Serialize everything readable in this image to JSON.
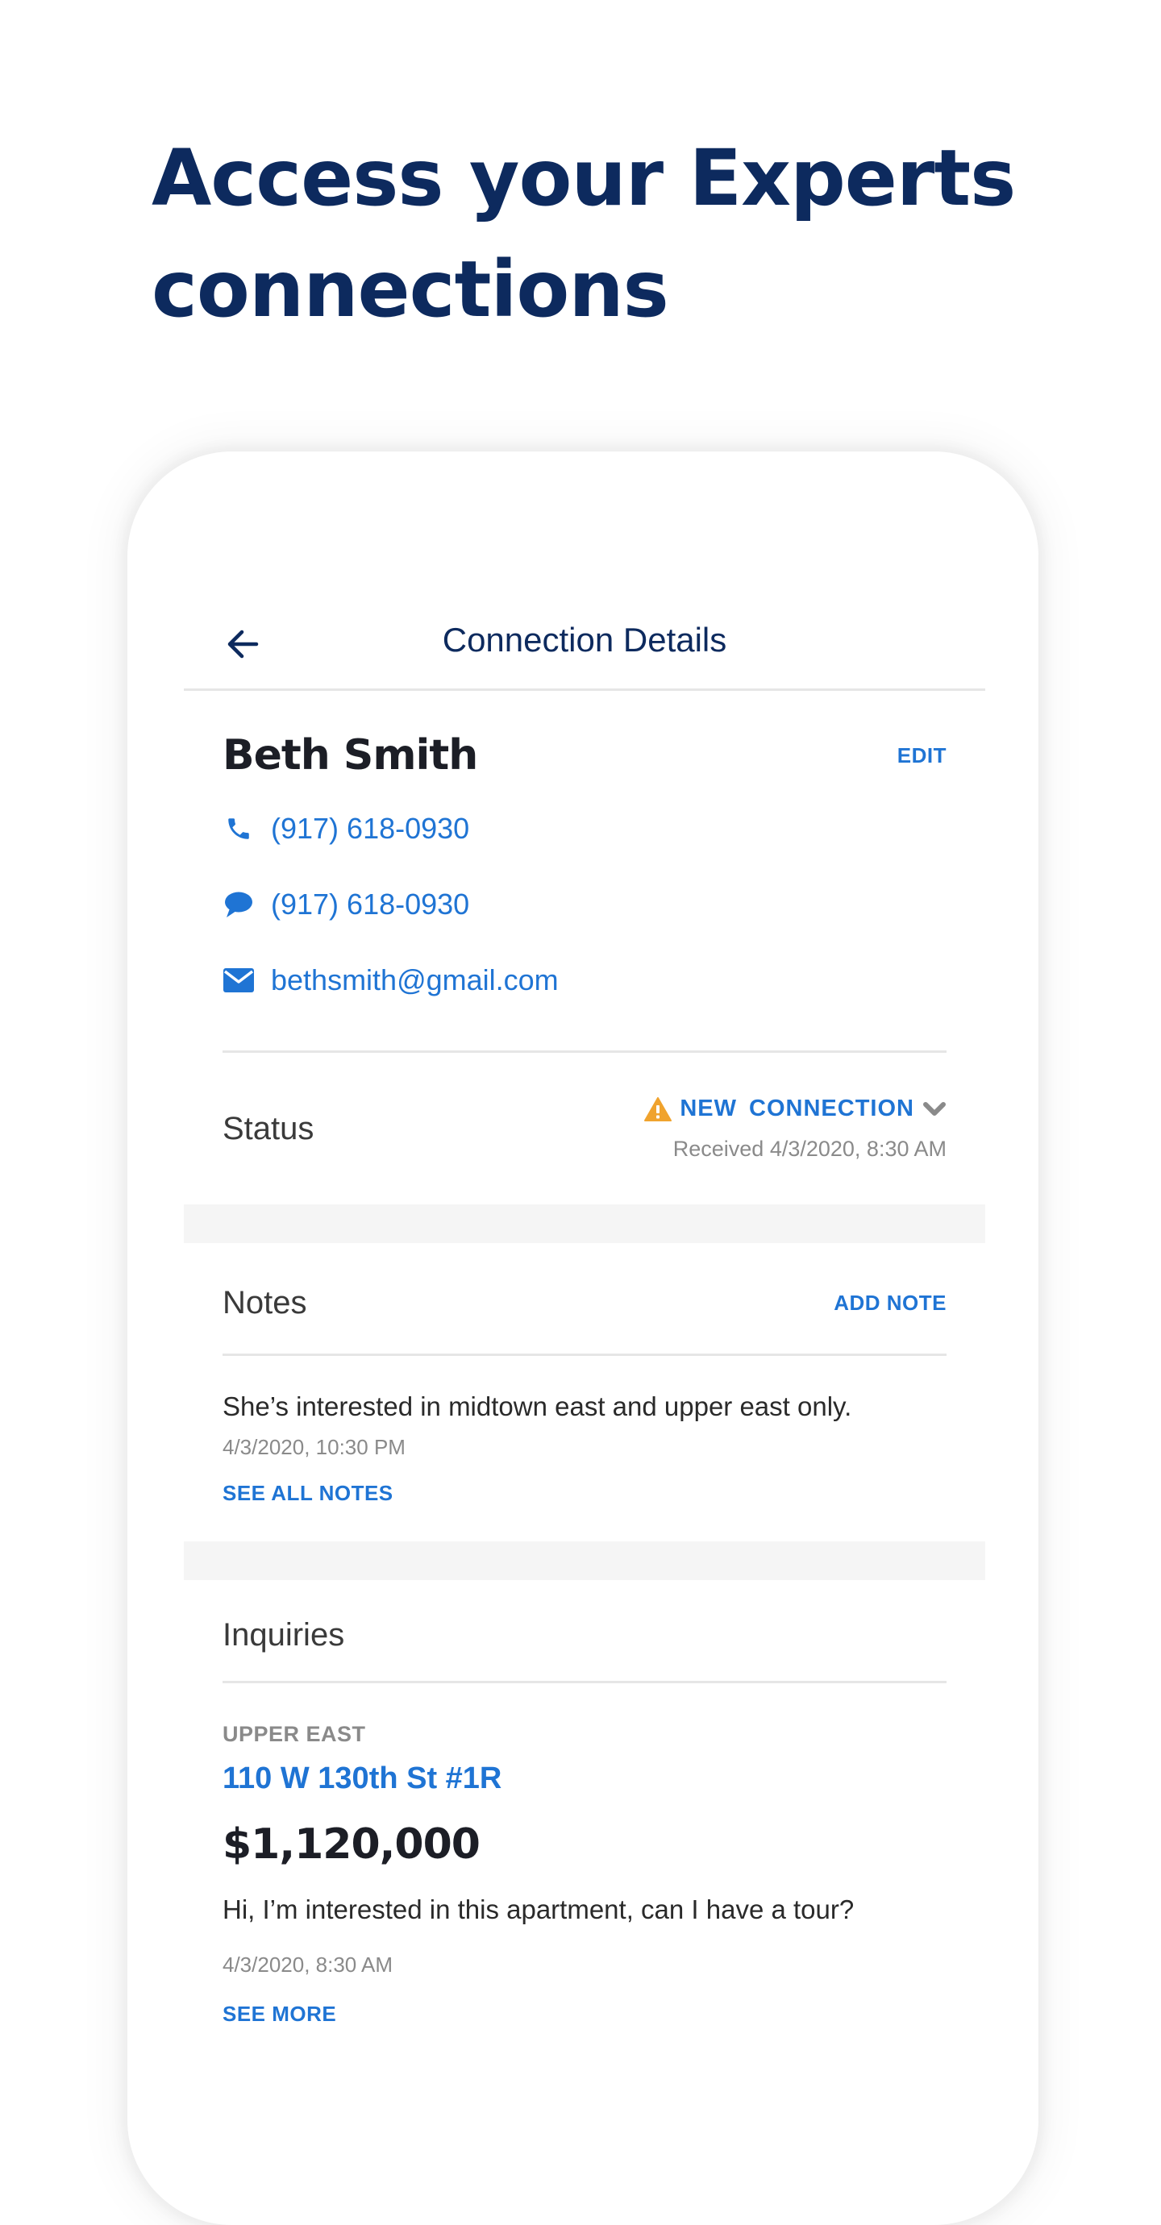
{
  "headline": {
    "line1": "Access your Experts",
    "line2": "connections"
  },
  "header": {
    "title": "Connection Details",
    "back_icon": "arrow-left-icon"
  },
  "contact": {
    "name": "Beth Smith",
    "edit_label": "EDIT",
    "rows": [
      {
        "icon": "phone-icon",
        "value": "(917) 618-0930"
      },
      {
        "icon": "chat-bubble-icon",
        "value": "(917) 618-0930"
      },
      {
        "icon": "envelope-icon",
        "value": "bethsmith@gmail.com"
      }
    ]
  },
  "status": {
    "label": "Status",
    "badge_icon": "warning-triangle-icon",
    "badge_text": "NEW CONNECTION",
    "dropdown_icon": "chevron-down-icon",
    "received": "Received 4/3/2020, 8:30 AM"
  },
  "notes": {
    "label": "Notes",
    "add_label": "ADD NOTE",
    "latest": {
      "text": "She’s interested in midtown east and upper east only.",
      "timestamp": "4/3/2020, 10:30 PM"
    },
    "see_all_label": "SEE ALL NOTES"
  },
  "inquiries": {
    "label": "Inquiries",
    "items": [
      {
        "neighborhood": "UPPER EAST",
        "address": "110 W 130th St #1R",
        "price": "$1,120,000",
        "message": "Hi, I’m interested in this apartment, can I have a tour?",
        "timestamp": "4/3/2020, 8:30 AM",
        "see_more_label": "SEE MORE"
      }
    ]
  },
  "colors": {
    "navy": "#0d2a5e",
    "link_blue": "#1f74d4",
    "warning_orange": "#f0a32e",
    "muted_gray": "#8a8a8a",
    "band_gray": "#f5f5f5"
  }
}
